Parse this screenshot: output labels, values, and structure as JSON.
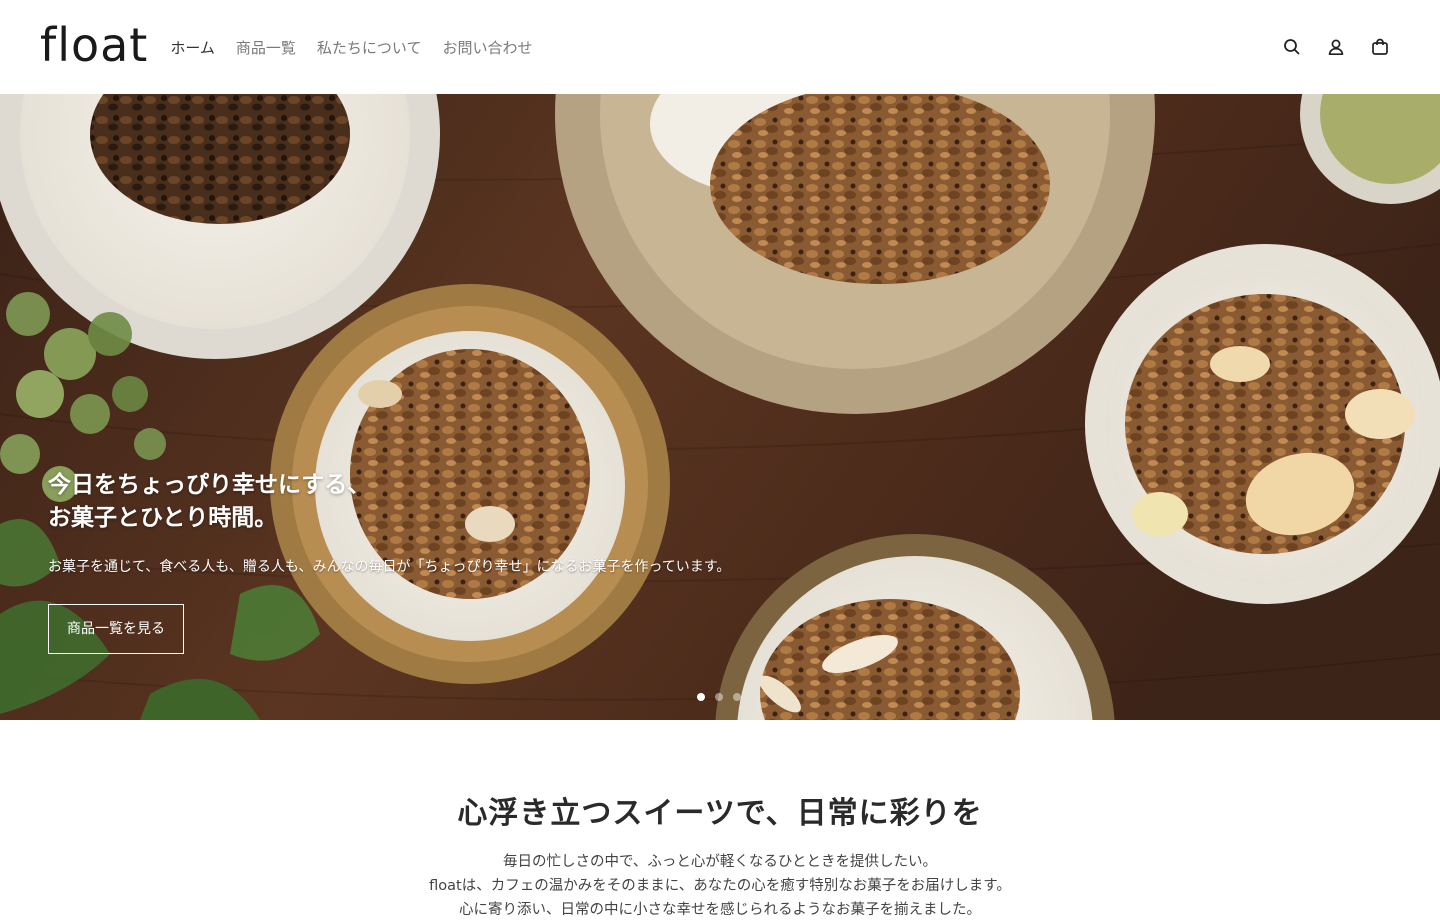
{
  "header": {
    "logo": "float",
    "nav": [
      {
        "label": "ホーム",
        "active": true
      },
      {
        "label": "商品一覧",
        "active": false
      },
      {
        "label": "私たちについて",
        "active": false
      },
      {
        "label": "お問い合わせ",
        "active": false
      }
    ],
    "icons": [
      "search-icon",
      "account-icon",
      "cart-icon"
    ]
  },
  "hero": {
    "title": "今日をちょっぴり幸せにする、\nお菓子とひとり時間。",
    "subtitle": "お菓子を通じて、食べる人も、贈る人も、みんなの毎日が「ちょっぴり幸せ」になるお菓子を作っています。",
    "button": "商品一覧を見る",
    "slides": 3,
    "active_slide": 0
  },
  "intro": {
    "title": "心浮き立つスイーツで、日常に彩りを",
    "lines": [
      "毎日の忙しさの中で、ふっと心が軽くなるひとときを提供したい。",
      "floatは、カフェの温かみをそのままに、あなたの心を癒す特別なお菓子をお届けします。",
      "心に寄り添い、日常の中に小さな幸せを感じられるようなお菓子を揃えました。"
    ]
  },
  "colors": {
    "text": "#222222",
    "nav_inactive": "#7a7a7a",
    "hero_wood": "#4a2a1a"
  }
}
